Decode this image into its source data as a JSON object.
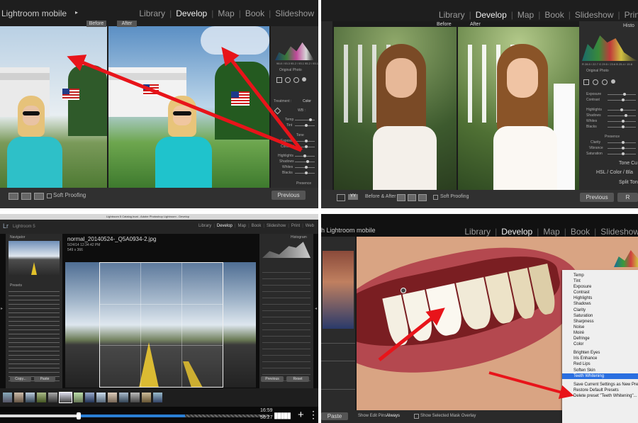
{
  "q1": {
    "brand": "Lightroom mobile",
    "modules": [
      "Library",
      "Develop",
      "Map",
      "Book",
      "Slideshow"
    ],
    "active_module": "Develop",
    "before_label": "Before",
    "after_label": "After",
    "hist_values": "98.8 / 93.3  95.2 / 93.1  95.2 / 93.1",
    "original_photo": "Original Photo",
    "treatment_label": "Treatment :",
    "treatment_value": "Color",
    "wb_label": "WB :",
    "temp": "Temp",
    "tint": "Tint",
    "tone": "Tone",
    "exposure": "Exposure",
    "contrast": "Contrast",
    "highlights": "Highlights",
    "shadows": "Shadows",
    "whites": "Whites",
    "blacks": "Blacks",
    "presence": "Presence",
    "soft_proofing": "Soft Proofing",
    "previous": "Previous"
  },
  "q2": {
    "modules": [
      "Library",
      "Develop",
      "Map",
      "Book",
      "Slideshow",
      "Prin"
    ],
    "active_module": "Develop",
    "before_label": "Before",
    "after_label": "After",
    "histogram": "Histo",
    "hist_values": "R 28.5 / 22.7   G 29.5 / 23.6   B 25.4 / 15.6",
    "original_photo": "Original Photo",
    "sliders": [
      "Exposure",
      "Contrast",
      "Highlights",
      "Shadows",
      "Whites",
      "Blacks"
    ],
    "presence": "Presence",
    "presence_sliders": [
      "Clarity",
      "Vibrance",
      "Saturation"
    ],
    "tone_curve": "Tone Cu",
    "hsl": "HSL / Color / Bla",
    "split_toning": "Split Ton",
    "before_after": "Before & After :",
    "soft_proofing": "Soft Proofing",
    "previous": "Previous",
    "reset": "R"
  },
  "q3": {
    "window_title": "Lightroom 5 Catalog.lrcat - Adobe Photoshop Lightroom - Develop",
    "logo": "Lr",
    "app_name": "Lightroom 5",
    "modules": [
      "Library",
      "Develop",
      "Map",
      "Book",
      "Slideshow",
      "Print",
      "Web"
    ],
    "active_module": "Develop",
    "navigator": "Navigator",
    "presets": "Presets",
    "filename": "normal_20140524-_Q5A0934-2.jpg",
    "timestamp": "5/24/14 12:34:42 PM",
    "dimensions": "549 x 366",
    "histogram": "Histogram",
    "copy": "Copy...",
    "paste": "Paste",
    "previous": "Previous",
    "reset": "Reset",
    "time_elapsed": "16:59",
    "time_remaining": "56:27"
  },
  "q4": {
    "brand": "h Lightroom mobile",
    "modules": [
      "Library",
      "Develop",
      "Map",
      "Book",
      "Slideshow"
    ],
    "active_module": "Develop",
    "paste": "Paste",
    "show_edit_pins": "Show Edit Pins :",
    "show_edit_pins_value": "Always",
    "show_mask": "Show Selected Mask Overlay",
    "menu_items": [
      "Temp",
      "Tint",
      "Exposure",
      "Contrast",
      "Highlights",
      "Shadows",
      "Clarity",
      "Saturation",
      "Sharpness",
      "Noise",
      "Moiré",
      "Defringe",
      "Color"
    ],
    "menu_items2": [
      "Brighten Eyes",
      "Iris Enhance",
      "Red Lips",
      "Soften Skin",
      "Teeth Whitening"
    ],
    "menu_items3": [
      "Save Current Settings as New Preset...",
      "Restore Default Presets",
      "Delete preset \"Teeth Whitening\"..."
    ],
    "selected_item": "Teeth Whitening"
  },
  "colors": {
    "arrow": "#e8141a",
    "ui_dark": "#1e1e1e",
    "panel": "#2c2c2c",
    "menu_highlight": "#2a6fe0",
    "progress": "#2a7fd4"
  }
}
